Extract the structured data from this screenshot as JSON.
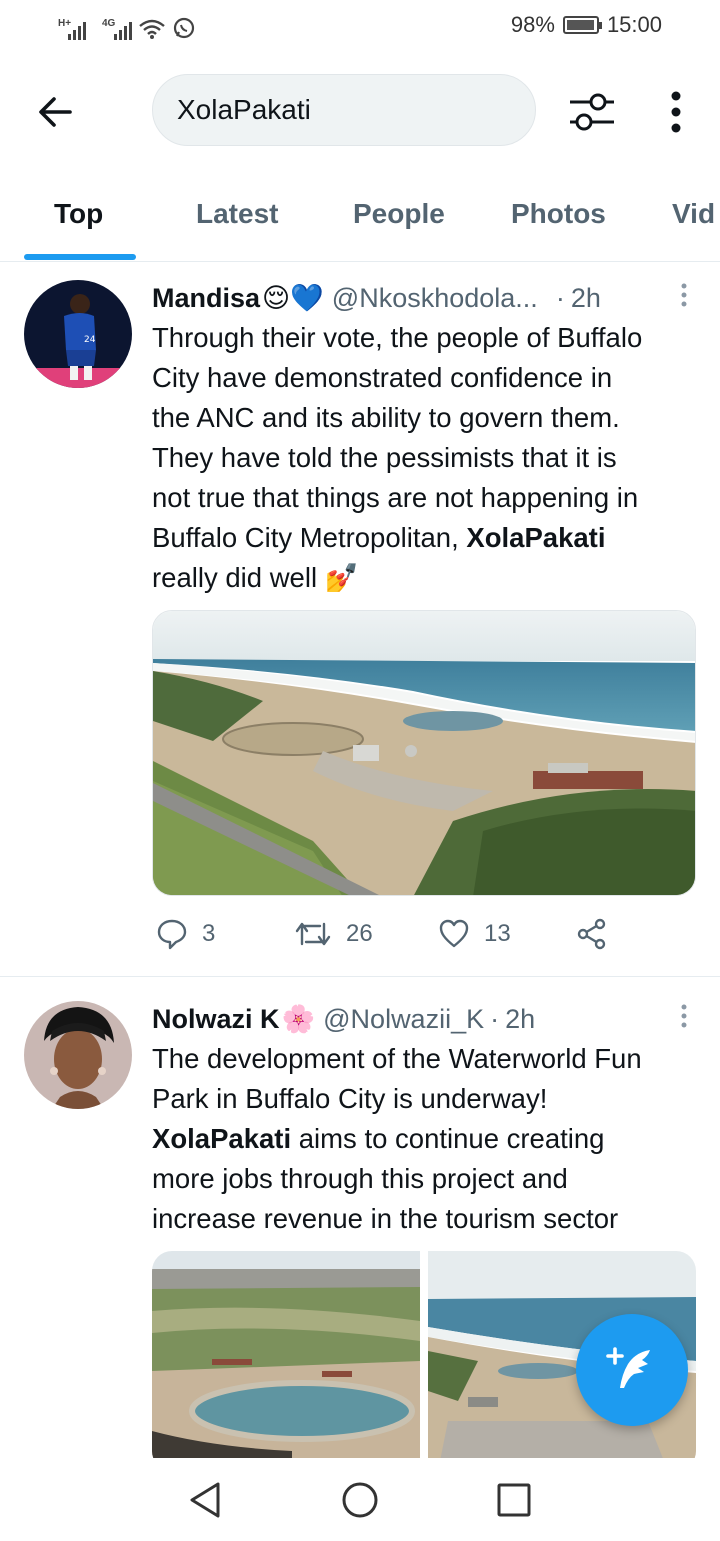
{
  "status_bar": {
    "net1": "H+",
    "net2": "4G",
    "battery_text": "98%",
    "battery_level": 0.98,
    "time": "15:00"
  },
  "search": {
    "query": "XolaPakati"
  },
  "tabs": [
    {
      "label": "Top",
      "active": true
    },
    {
      "label": "Latest",
      "active": false
    },
    {
      "label": "People",
      "active": false
    },
    {
      "label": "Photos",
      "active": false
    },
    {
      "label": "Vid",
      "active": false
    }
  ],
  "tweets": [
    {
      "name": "Mandisa",
      "name_emoji": "😌💙",
      "handle": "@Nkoskhodola...",
      "separator": "·",
      "time": "2h",
      "text_lines": [
        "Through their vote, the people of Buffalo",
        "City have demonstrated confidence in",
        "the ANC and its ability to govern them.",
        "They have told the pessimists that it is",
        "not true that things are not happening in"
      ],
      "text_line6_pre": "Buffalo City Metropolitan, ",
      "text_bold": "XolaPakati",
      "text_line7": "really did well",
      "text_emoji": "💅",
      "replies": "3",
      "retweets": "26",
      "likes": "13"
    },
    {
      "name": "Nolwazi K",
      "name_emoji": "🌸",
      "handle": "@Nolwazii_K",
      "separator": "·",
      "time": "2h",
      "text_lines": [
        "The development of the Waterworld Fun",
        "Park in Buffalo City is underway!"
      ],
      "text_bold": "XolaPakati",
      "text_line3_post": " aims to continue creating",
      "text_lines_after": [
        "more jobs through this project and",
        "increase revenue in the tourism sector"
      ]
    }
  ],
  "colors": {
    "accent": "#1d9bf0",
    "text": "#0f1419",
    "secondary": "#536471"
  }
}
